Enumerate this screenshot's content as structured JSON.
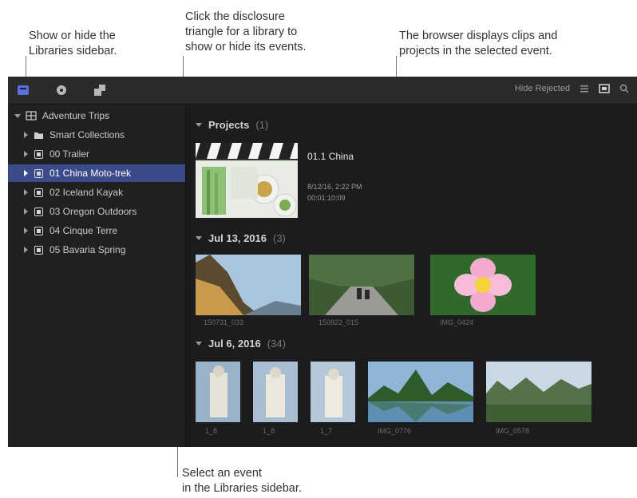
{
  "callouts": {
    "sidebar_toggle": [
      "Show or hide the",
      "Libraries sidebar."
    ],
    "disclosure": [
      "Click the disclosure",
      "triangle for a library to",
      "show or hide its events."
    ],
    "browser": [
      "The browser displays clips and",
      "projects in the selected event."
    ],
    "select_event": [
      "Select an event",
      "in the Libraries sidebar."
    ]
  },
  "toolbar": {
    "filter_label": "Hide Rejected",
    "icons": [
      "libraries-icon",
      "photos-audio-icon",
      "titles-generators-icon",
      "list-view-icon",
      "filmstrip-icon",
      "search-icon"
    ]
  },
  "sidebar": {
    "library": "Adventure Trips",
    "items": [
      {
        "label": "Smart Collections",
        "icon": "folder-icon"
      },
      {
        "label": "00 Trailer",
        "icon": "event-icon"
      },
      {
        "label": "01 China Moto-trek",
        "icon": "event-icon",
        "selected": true
      },
      {
        "label": "02 Iceland Kayak",
        "icon": "event-icon"
      },
      {
        "label": "03 Oregon Outdoors",
        "icon": "event-icon"
      },
      {
        "label": "04 Cinque Terre",
        "icon": "event-icon"
      },
      {
        "label": "05 Bavaria Spring",
        "icon": "event-icon"
      }
    ]
  },
  "browser": {
    "sections": [
      {
        "title": "Projects",
        "count": "(1)"
      },
      {
        "title": "Jul 13, 2016",
        "count": "(3)"
      },
      {
        "title": "Jul 6, 2016",
        "count": "(34)"
      }
    ],
    "project": {
      "name": "01.1 China",
      "date": "8/12/16, 2:22 PM",
      "duration": "00:01:10:09"
    },
    "clips_row1": [
      "150731_033",
      "150822_015",
      "IMG_0424"
    ],
    "clips_row2": [
      "1_8",
      "1_8",
      "1_7",
      "IMG_0776",
      "IMG_0578"
    ]
  },
  "colors": {
    "selection": "#3b4a8a",
    "app_bg": "#1c1c1e",
    "accent_icon": "#5b6ee1"
  }
}
